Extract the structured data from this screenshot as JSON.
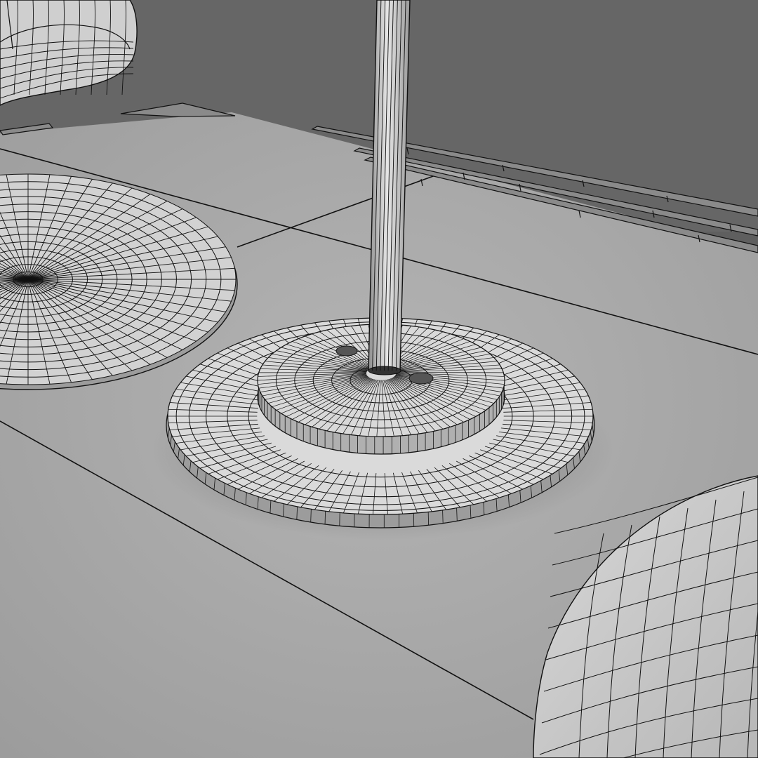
{
  "scene": {
    "kind": "3d-wireframe-render",
    "objects": [
      "floor-lamp-base",
      "lamp-pole",
      "round-rug",
      "ottoman",
      "armchair",
      "baseboard-trim",
      "floor-panels"
    ]
  },
  "palette": {
    "wall": "#666666",
    "floor": "#a9a9a9",
    "mesh-fill": "#c9c9c9",
    "mesh-light": "#dedede",
    "wire": "#111111"
  }
}
